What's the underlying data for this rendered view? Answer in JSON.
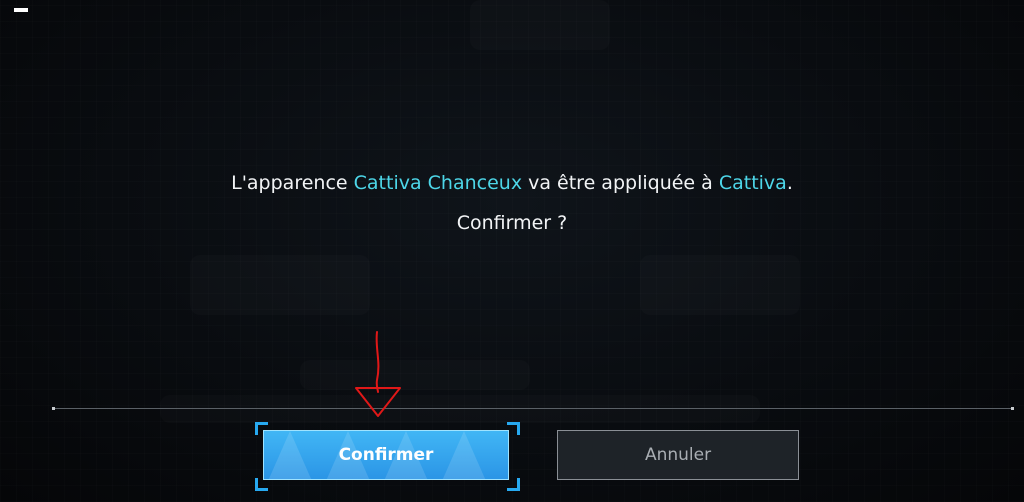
{
  "dialog": {
    "message_prefix": "L'apparence ",
    "skin_name": "Cattiva Chanceux",
    "message_middle": " va être appliquée à ",
    "pal_name": "Cattiva",
    "message_suffix": ".",
    "question": "Confirmer ?",
    "highlight_color": "#4dd6e8"
  },
  "buttons": {
    "confirm_label": "Confirmer",
    "cancel_label": "Annuler",
    "confirm_color": "#3aaaf0"
  },
  "annotation": {
    "type": "red-arrow-pointing-down",
    "color": "#e01818"
  }
}
